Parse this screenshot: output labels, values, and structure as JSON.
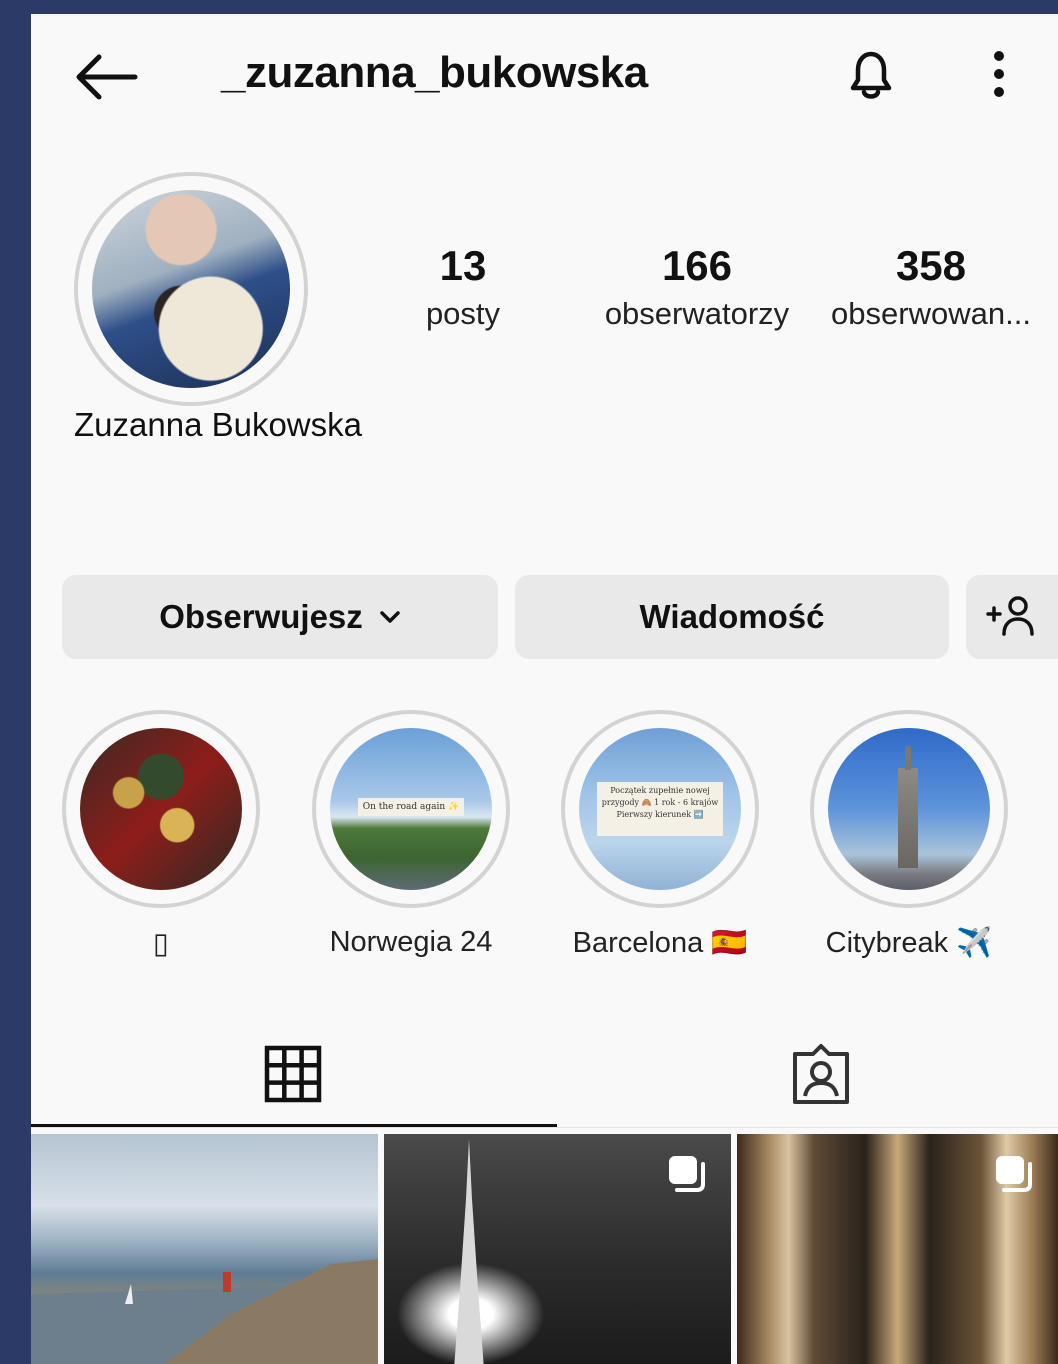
{
  "header": {
    "username": "_zuzanna_bukowska",
    "back_icon": "arrow-left-icon",
    "bell_icon": "bell-icon",
    "more_icon": "more-vertical-icon"
  },
  "profile": {
    "full_name": "Zuzanna Bukowska",
    "stats": [
      {
        "value": "13",
        "label": "posty"
      },
      {
        "value": "166",
        "label": "obserwatorzy"
      },
      {
        "value": "358",
        "label": "obserwowan..."
      }
    ]
  },
  "actions": {
    "follow_label": "Obserwujesz",
    "message_label": "Wiadomość",
    "add_person_icon": "add-person-icon"
  },
  "highlights": [
    {
      "label": "▯"
    },
    {
      "label": "Norwegia 24",
      "overlay_text": "On the road again ✨"
    },
    {
      "label": "Barcelona 🇪🇸",
      "overlay_text": "Początek zupełnie nowej przygody 🙈 1 rok - 6 krajów Pierwszy kierunek ➡️"
    },
    {
      "label": "Citybreak ✈️"
    }
  ],
  "tabs": [
    {
      "icon": "grid-icon",
      "active": true
    },
    {
      "icon": "tagged-icon",
      "active": false
    }
  ],
  "colors": {
    "frame": "#2b3a66",
    "background": "#f9f9f9",
    "button": "#e9e9e9"
  }
}
